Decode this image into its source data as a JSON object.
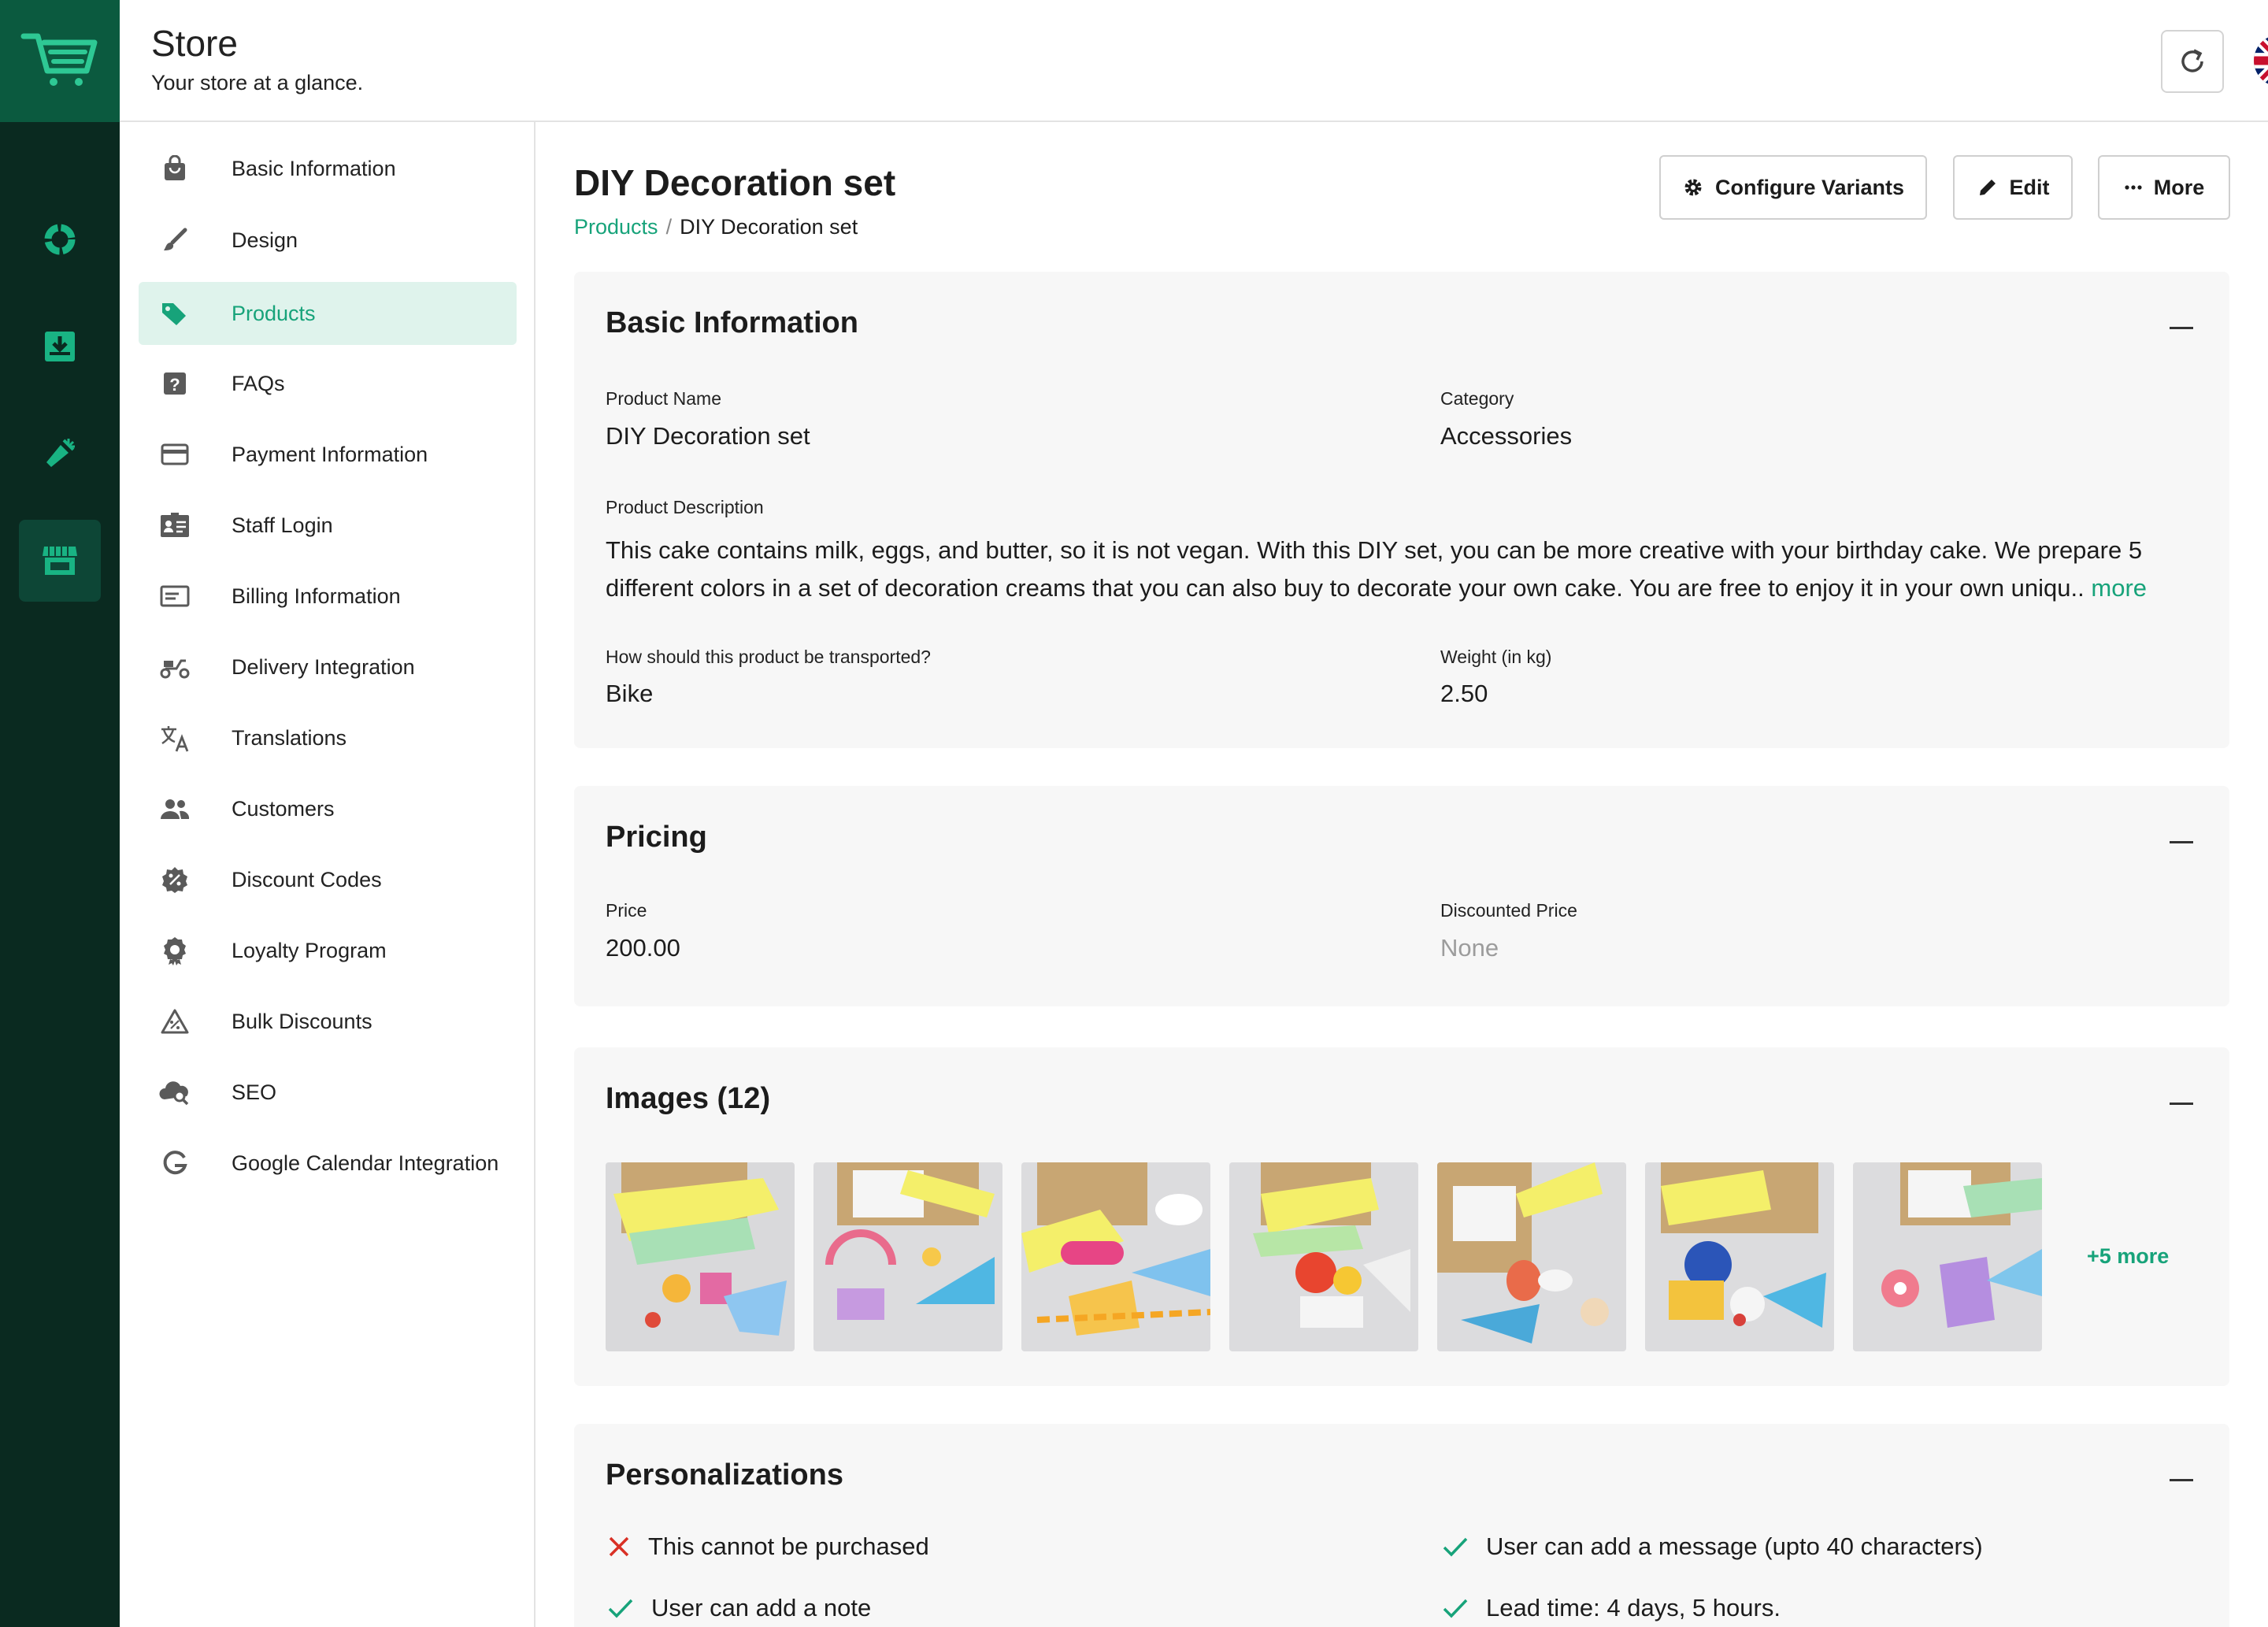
{
  "header": {
    "title": "Store",
    "subtitle": "Your store at a glance.",
    "refresh_icon": "refresh-icon",
    "language_flag": "uk-flag"
  },
  "rail": {
    "items": [
      {
        "icon": "analytics-icon"
      },
      {
        "icon": "inbox-download-icon"
      },
      {
        "icon": "megaphone-icon"
      },
      {
        "icon": "store-icon",
        "active": true
      }
    ]
  },
  "sidebar": {
    "items": [
      {
        "label": "Basic Information",
        "icon": "shopping-bag-icon"
      },
      {
        "label": "Design",
        "icon": "brush-icon"
      },
      {
        "label": "Products",
        "icon": "tags-icon",
        "active": true
      },
      {
        "label": "FAQs",
        "icon": "question-icon"
      },
      {
        "label": "Payment Information",
        "icon": "credit-card-icon"
      },
      {
        "label": "Staff Login",
        "icon": "id-card-icon"
      },
      {
        "label": "Billing Information",
        "icon": "billing-card-icon"
      },
      {
        "label": "Delivery Integration",
        "icon": "scooter-icon"
      },
      {
        "label": "Translations",
        "icon": "translate-icon"
      },
      {
        "label": "Customers",
        "icon": "people-icon"
      },
      {
        "label": "Discount Codes",
        "icon": "percent-badge-icon"
      },
      {
        "label": "Loyalty Program",
        "icon": "award-icon"
      },
      {
        "label": "Bulk Discounts",
        "icon": "triangle-percent-icon"
      },
      {
        "label": "SEO",
        "icon": "cloud-search-icon"
      },
      {
        "label": "Google Calendar Integration",
        "icon": "google-icon"
      }
    ]
  },
  "main": {
    "title": "DIY Decoration set",
    "breadcrumb": {
      "link": "Products",
      "separator": "/",
      "current": "DIY Decoration set"
    },
    "toolbar": {
      "configure_variants": "Configure Variants",
      "edit": "Edit",
      "more": "More"
    },
    "basic_info": {
      "title": "Basic Information",
      "product_name_label": "Product Name",
      "product_name": "DIY Decoration set",
      "category_label": "Category",
      "category": "Accessories",
      "description_label": "Product Description",
      "description": "This cake contains milk, eggs, and butter, so it is not vegan. With this DIY set, you can be more creative with your birthday cake. We prepare 5 different colors in a set of decoration creams that you can also buy to decorate your own cake. You are free to enjoy it in your own uniqu..",
      "description_more": "more",
      "transport_label": "How should this product be transported?",
      "transport": "Bike",
      "weight_label": "Weight (in kg)",
      "weight": "2.50"
    },
    "pricing": {
      "title": "Pricing",
      "price_label": "Price",
      "price": "200.00",
      "discounted_label": "Discounted Price",
      "discounted": "None"
    },
    "images": {
      "title": "Images (12)",
      "more": "+5 more"
    },
    "personalizations": {
      "title": "Personalizations",
      "items": [
        {
          "text": "This cannot be purchased",
          "status": "no"
        },
        {
          "text": "User can add a message (upto 40 characters)",
          "status": "yes"
        },
        {
          "text": "User can add a note",
          "status": "yes"
        },
        {
          "text": "Lead time: 4 days, 5 hours.",
          "status": "yes"
        }
      ]
    }
  },
  "colors": {
    "accent": "#17a37a",
    "rail_bg": "#0a2a20",
    "rail_logo_bg": "#0b5a3f",
    "active_bg": "#dff3ec",
    "error": "#d93025"
  }
}
